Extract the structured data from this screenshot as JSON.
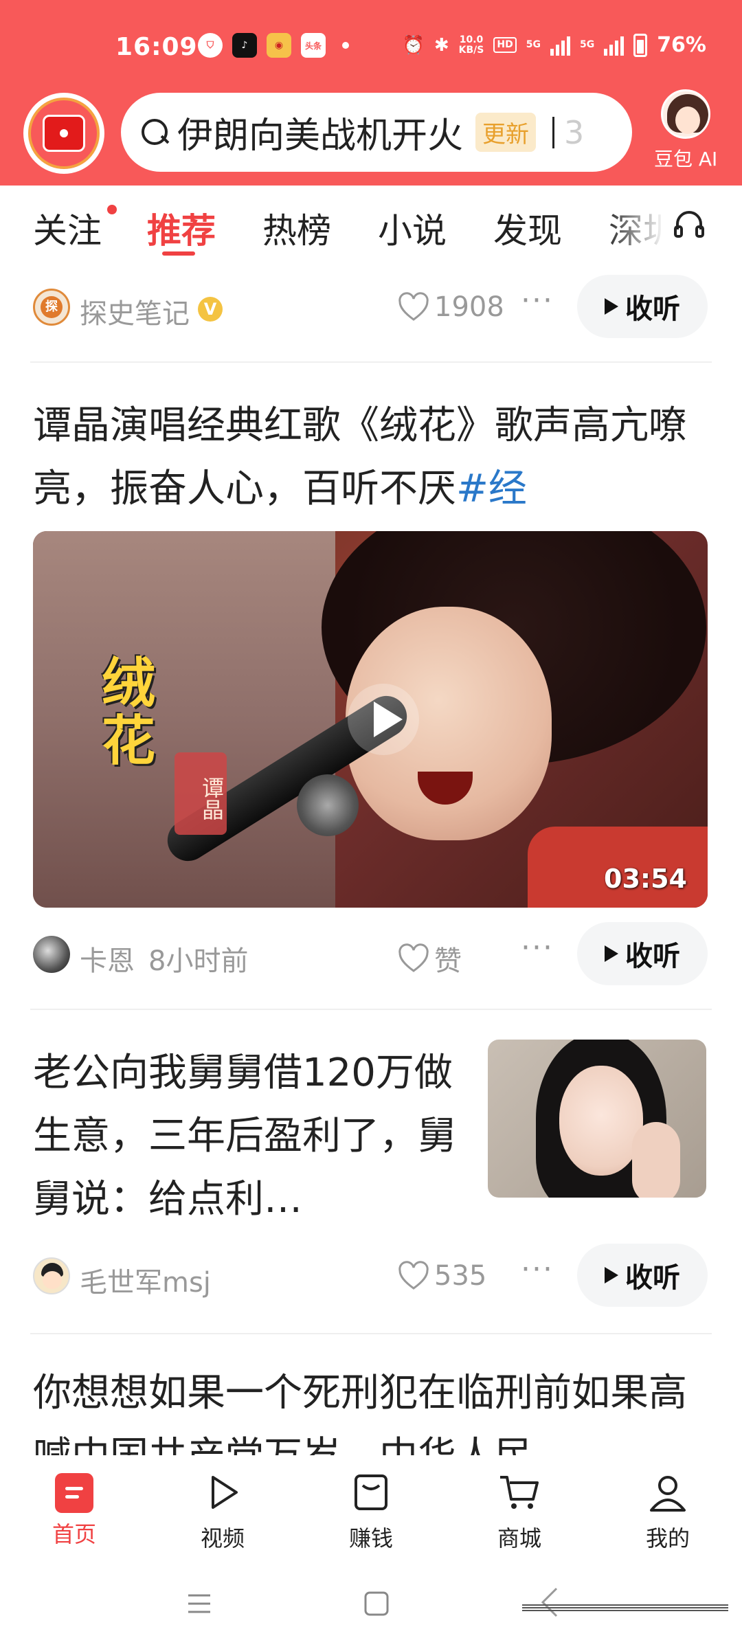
{
  "status_bar": {
    "time": "16:09",
    "net_speed": "10.0\nKB/S",
    "hd": "HD",
    "signal_5g_1": "5G",
    "signal_5g_2": "5G",
    "battery": "76%",
    "app_toutiao_mini": "头条"
  },
  "search": {
    "query": "伊朗向美战机开火",
    "badge": "更新",
    "trailing": "3"
  },
  "ai": {
    "label": "豆包 AI"
  },
  "tabs": [
    {
      "label": "关注"
    },
    {
      "label": "推荐"
    },
    {
      "label": "热榜"
    },
    {
      "label": "小说"
    },
    {
      "label": "发现"
    },
    {
      "label": "深圳"
    }
  ],
  "feed": {
    "item0": {
      "author": "探史笔记",
      "likes": "1908",
      "listen": "收听"
    },
    "item1": {
      "title": "谭晶演唱经典红歌《绒花》歌声高亢嘹亮，振奋人心，百听不厌",
      "hashtag": "#经",
      "video_title": "绒花",
      "video_name": "谭晶",
      "duration": "03:54",
      "author": "卡恩",
      "time": "8小时前",
      "likes": "赞",
      "listen": "收听"
    },
    "item2": {
      "title": "老公向我舅舅借120万做生意，三年后盈利了，舅舅说：给点利…",
      "author": "毛世军msj",
      "likes": "535",
      "listen": "收听"
    },
    "item3": {
      "title": "你想想如果一个死刑犯在临刑前如果高喊中国共产党万岁，中华人民"
    }
  },
  "bottom_nav": [
    {
      "label": "首页",
      "icon": "home-icon"
    },
    {
      "label": "视频",
      "icon": "video-icon"
    },
    {
      "label": "赚钱",
      "icon": "wallet-icon"
    },
    {
      "label": "商城",
      "icon": "cart-icon"
    },
    {
      "label": "我的",
      "icon": "profile-icon"
    }
  ],
  "colors": {
    "brand_red": "#f85959",
    "active_red": "#f04142",
    "hashtag_blue": "#2a78c9"
  }
}
